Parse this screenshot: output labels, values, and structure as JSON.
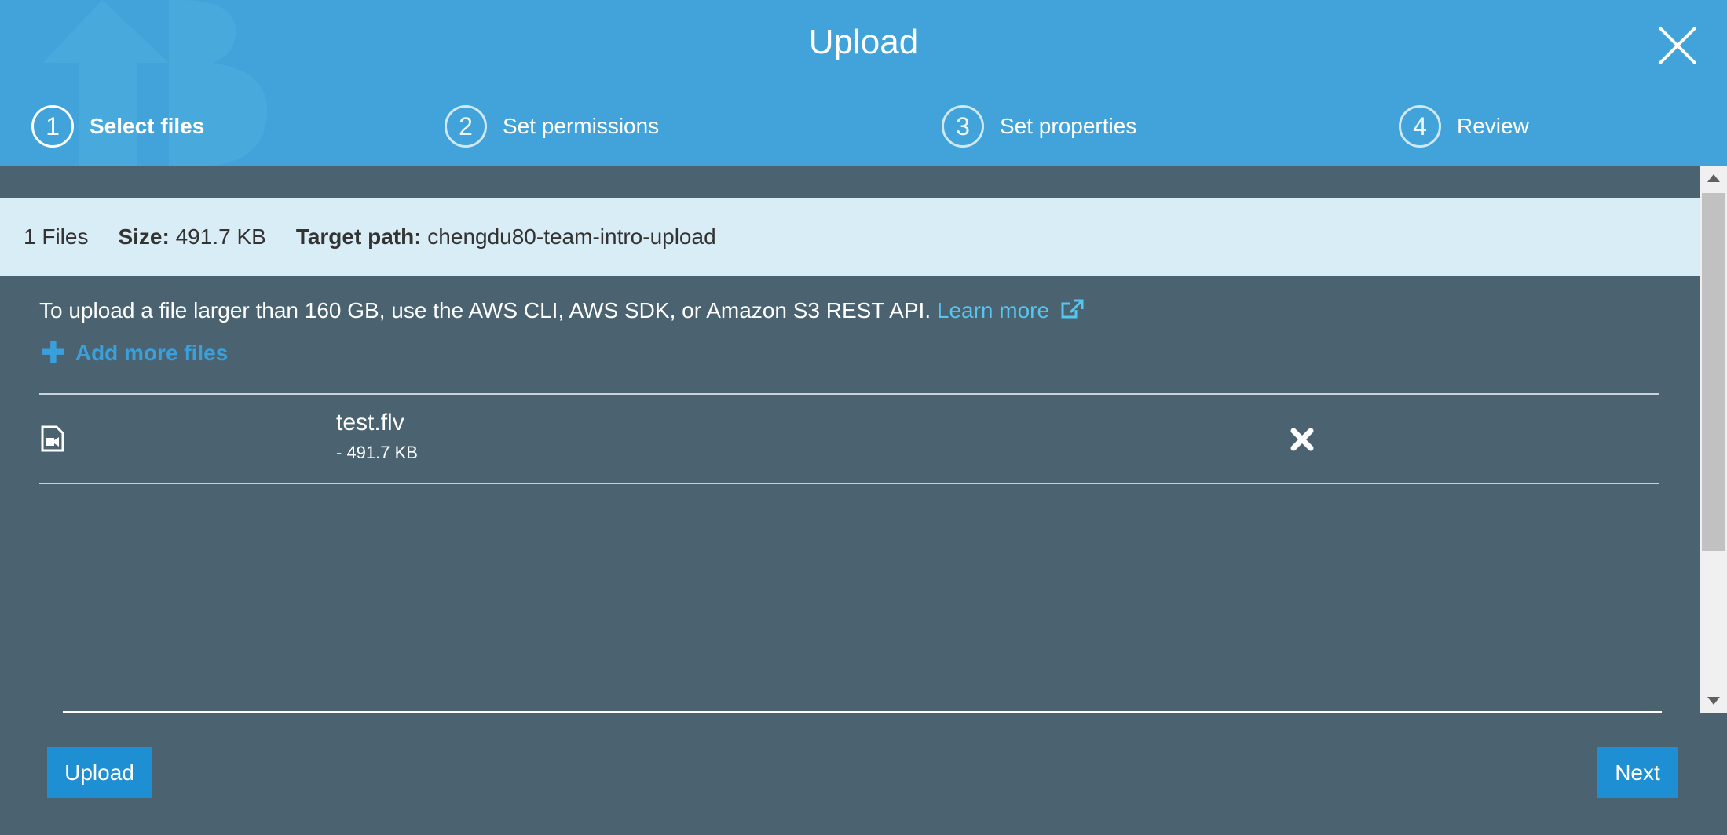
{
  "header": {
    "title": "Upload",
    "steps": [
      {
        "number": "1",
        "label": "Select files",
        "active": true
      },
      {
        "number": "2",
        "label": "Set permissions",
        "active": false
      },
      {
        "number": "3",
        "label": "Set properties",
        "active": false
      },
      {
        "number": "4",
        "label": "Review",
        "active": false
      }
    ]
  },
  "summary": {
    "files_count": "1 Files",
    "size_label": "Size:",
    "size_value": "491.7 KB",
    "target_label": "Target path:",
    "target_value": "chengdu80-team-intro-upload"
  },
  "notice": {
    "text": "To upload a file larger than 160 GB, use the AWS CLI, AWS SDK, or Amazon S3 REST API.",
    "link_text": "Learn more"
  },
  "add_files_label": "Add more files",
  "files": [
    {
      "name": "test.flv",
      "size": "- 491.7 KB",
      "icon": "video-file-icon"
    }
  ],
  "footer": {
    "upload_label": "Upload",
    "next_label": "Next"
  },
  "colors": {
    "header_bg": "#41a3d9",
    "body_bg": "#4b6371",
    "info_bg": "#d9edf6",
    "link": "#55c6f0",
    "button": "#1f8fd3"
  }
}
